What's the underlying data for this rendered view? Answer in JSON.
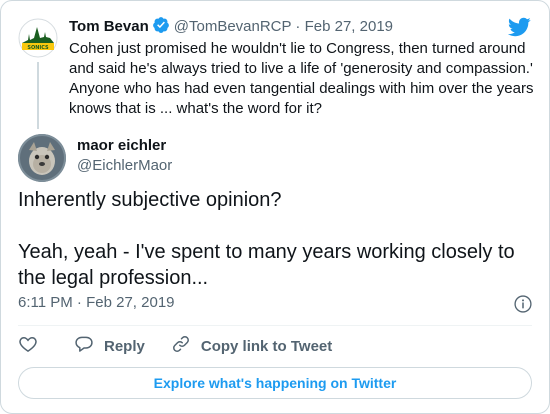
{
  "parent_tweet": {
    "author_name": "Tom Bevan",
    "author_handle": "@TomBevanRCP",
    "separator": "·",
    "date": "Feb 27, 2019",
    "text": "Cohen just promised he wouldn't lie to Congress, then turned around and said he's always tried to live a life of 'generosity and compassion.' Anyone who has had even tangential dealings with him over the years knows that is ... what's the word for it?",
    "verified": true
  },
  "main_tweet": {
    "author_name": "maor eichler",
    "author_handle": "@EichlerMaor",
    "text": "Inherently subjective opinion?\n\nYeah, yeah - I've spent to many years working closely to the legal profession...",
    "time": "6:11 PM",
    "separator": "·",
    "date": "Feb 27, 2019"
  },
  "actions": {
    "like_label": "",
    "reply_label": "Reply",
    "copy_link_label": "Copy link to Tweet"
  },
  "footer": {
    "explore_label": "Explore what's happening on Twitter"
  },
  "colors": {
    "accent": "#1d9bf0",
    "text_primary": "#0f1419",
    "text_secondary": "#536471",
    "border": "#cfd9de"
  },
  "icons": [
    "twitter-bird-icon",
    "verified-badge-icon",
    "info-icon",
    "heart-icon",
    "reply-icon",
    "link-icon"
  ]
}
